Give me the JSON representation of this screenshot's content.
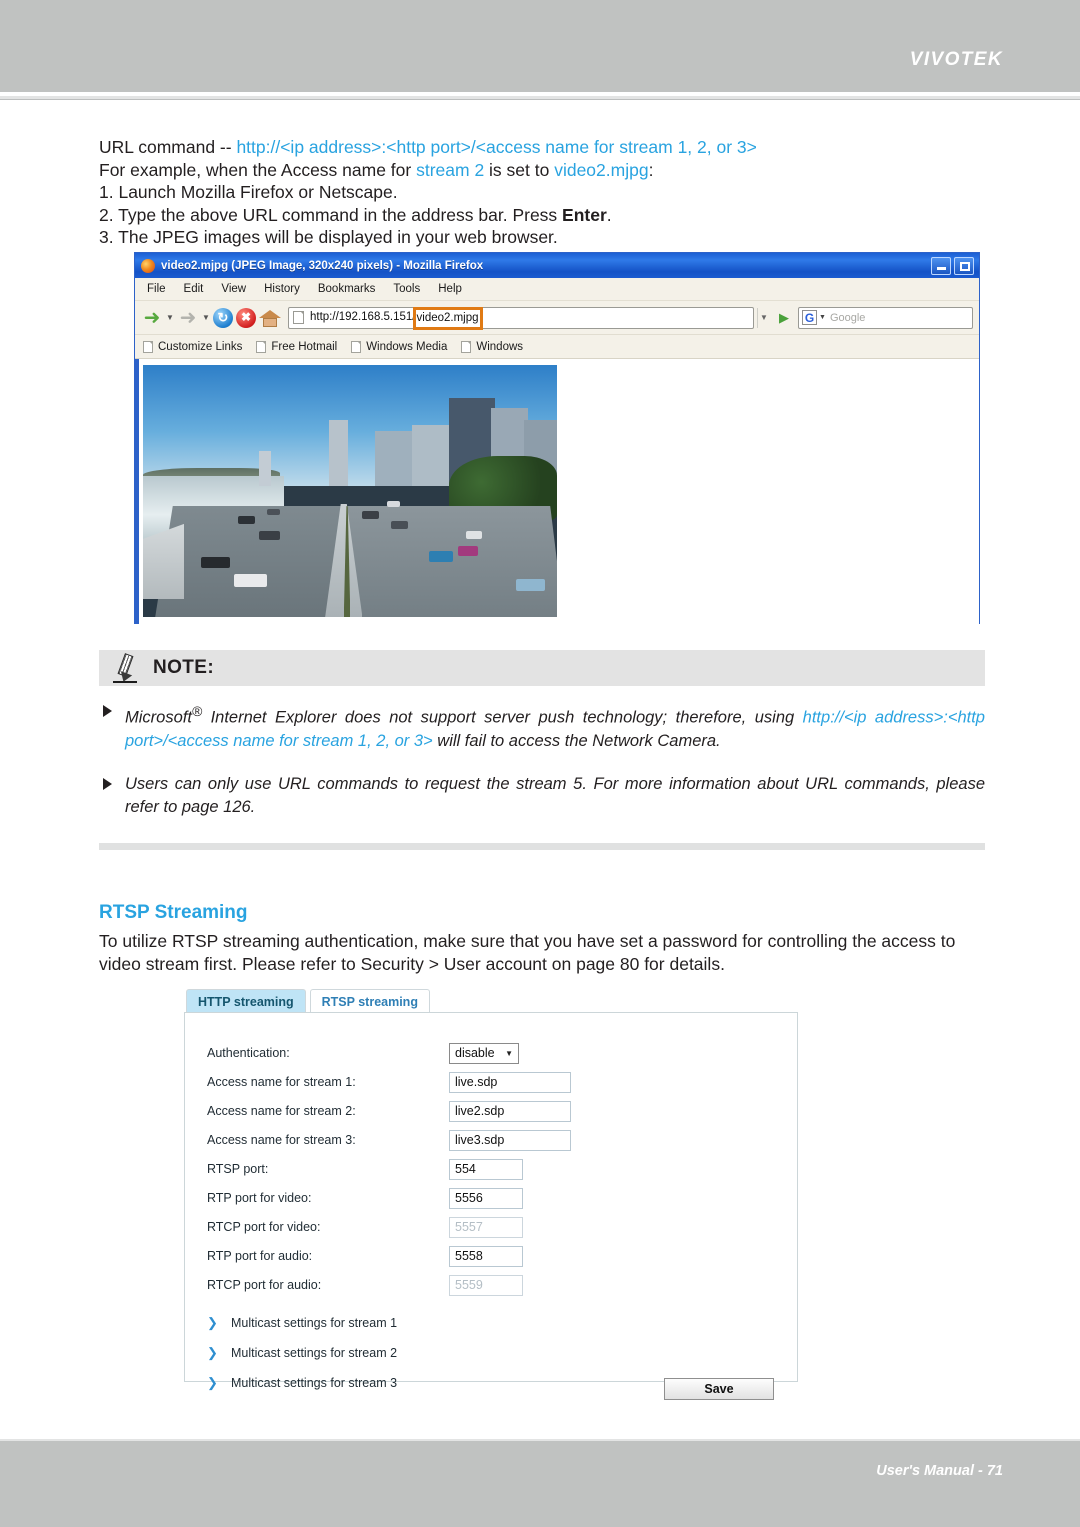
{
  "header": {
    "brand": "VIVOTEK"
  },
  "intro": {
    "line1_prefix": "URL command -- ",
    "line1_link": "http://<ip address>:<http port>/<access name for stream 1, 2, or 3>",
    "line2_a": "For example, when the Access name for ",
    "line2_blue1": "stream 2",
    "line2_b": " is set to ",
    "line2_blue2": "video2.mjpg",
    "line2_c": ":",
    "step1": "1. Launch Mozilla Firefox or Netscape.",
    "step2_a": "2. Type the above URL command in the address bar. Press ",
    "step2_bold": "Enter",
    "step2_b": ".",
    "step3": "3. The JPEG images will be displayed in your web browser."
  },
  "browser": {
    "title": "video2.mjpg (JPEG Image, 320x240 pixels) - Mozilla Firefox",
    "window_buttons": [
      "minimize",
      "maximize"
    ],
    "menu": [
      "File",
      "Edit",
      "View",
      "History",
      "Bookmarks",
      "Tools",
      "Help"
    ],
    "toolbar_icons": [
      "back-arrow-icon",
      "forward-arrow-icon",
      "reload-icon",
      "stop-icon",
      "home-icon"
    ],
    "url_prefix": "http://192.168.5.151/",
    "url_highlight": "video2.mjpg",
    "search_engine_glyph": "G",
    "search_placeholder": "Google",
    "bookmarks": [
      "Customize Links",
      "Free Hotmail",
      "Windows Media",
      "Windows"
    ]
  },
  "note": {
    "title": "NOTE:",
    "items": [
      {
        "a": "Microsoft",
        "sup": "®",
        "b": " Internet Explorer does not support server push technology; therefore, using ",
        "blue": "http://<ip address>:<http port>/<access name for stream 1, 2, or 3>",
        "c": " will fail to access the Network Camera."
      },
      {
        "a": "Users can only use URL commands to request the stream 5. For more information about URL commands, please refer to page 126.",
        "sup": "",
        "b": "",
        "blue": "",
        "c": ""
      }
    ]
  },
  "rtsp": {
    "title": "RTSP Streaming",
    "body": "To utilize RTSP streaming authentication, make sure that you have set a password for controlling the access to video stream first. Please refer to Security > User account on page 80 for details."
  },
  "settings": {
    "tabs": [
      {
        "label": "HTTP streaming",
        "active": true
      },
      {
        "label": "RTSP streaming",
        "active": false
      }
    ],
    "fields": [
      {
        "label": "Authentication:",
        "value": "disable",
        "type": "select",
        "disabled": false
      },
      {
        "label": "Access name for stream 1:",
        "value": "live.sdp",
        "type": "text-wide",
        "disabled": false
      },
      {
        "label": "Access name for stream 2:",
        "value": "live2.sdp",
        "type": "text-wide",
        "disabled": false
      },
      {
        "label": "Access name for stream 3:",
        "value": "live3.sdp",
        "type": "text-wide",
        "disabled": false
      },
      {
        "label": "RTSP port:",
        "value": "554",
        "type": "text-narrow",
        "disabled": false
      },
      {
        "label": "RTP port for video:",
        "value": "5556",
        "type": "text-narrow",
        "disabled": false
      },
      {
        "label": "RTCP port for video:",
        "value": "5557",
        "type": "text-narrow",
        "disabled": true
      },
      {
        "label": "RTP port for audio:",
        "value": "5558",
        "type": "text-narrow",
        "disabled": false
      },
      {
        "label": "RTCP port for audio:",
        "value": "5559",
        "type": "text-narrow",
        "disabled": true
      }
    ],
    "multicast_links": [
      "Multicast settings for stream 1",
      "Multicast settings for stream 2",
      "Multicast settings for stream 3"
    ],
    "save_label": "Save"
  },
  "footer": {
    "text": "User's Manual - 71"
  },
  "colors": {
    "accent_blue": "#29a3e0",
    "header_grey": "#c0c2c1",
    "note_band": "#e3e3e3",
    "highlight_orange": "#e07a14",
    "tab_active": "#bfe4f6"
  }
}
